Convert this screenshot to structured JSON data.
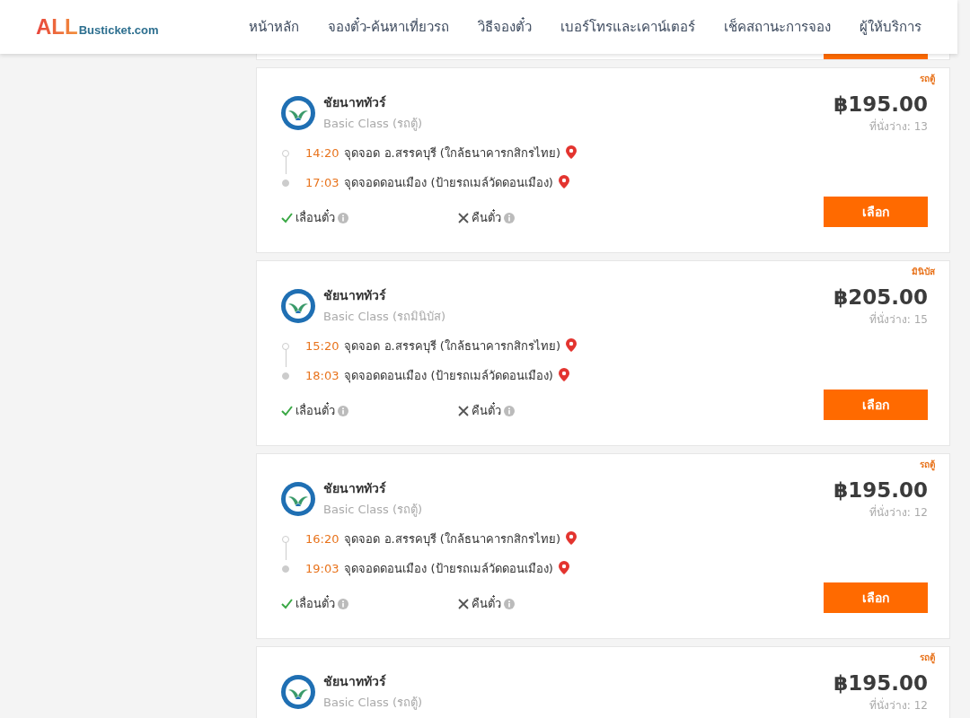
{
  "header": {
    "logo": {
      "brand": "ALL",
      "domain": "Busticket.com"
    },
    "nav": [
      "หน้าหลัก",
      "จองตั๋ว-ค้นหาเที่ยวรถ",
      "วิธีจองตั๋ว",
      "เบอร์โทรและเคาน์เตอร์",
      "เช็คสถานะการจอง",
      "ผู้ให้บริการ"
    ]
  },
  "results": [
    {
      "badge": "รถตู้",
      "operator": "ชัยนาททัวร์",
      "class": "Basic Class (รถตู้)",
      "price": "฿195.00",
      "seats": "ที่นั่งว่าง: 13",
      "stops": [
        {
          "time": "14:20",
          "place": "จุดจอด อ.สรรคบุรี (ใกล้ธนาคารกสิกรไทย)"
        },
        {
          "time": "17:03",
          "place": "จุดจอดดอนเมือง (ป้ายรถเมล์วัดดอนเมือง)"
        }
      ],
      "policies": [
        {
          "label": "เลื่อนตั๋ว",
          "allowed": true
        },
        {
          "label": "คืนตั๋ว",
          "allowed": false
        }
      ],
      "button": "เลือก"
    },
    {
      "badge": "มินิบัส",
      "operator": "ชัยนาททัวร์",
      "class": "Basic Class (รถมินิบัส)",
      "price": "฿205.00",
      "seats": "ที่นั่งว่าง: 15",
      "stops": [
        {
          "time": "15:20",
          "place": "จุดจอด อ.สรรคบุรี (ใกล้ธนาคารกสิกรไทย)"
        },
        {
          "time": "18:03",
          "place": "จุดจอดดอนเมือง (ป้ายรถเมล์วัดดอนเมือง)"
        }
      ],
      "policies": [
        {
          "label": "เลื่อนตั๋ว",
          "allowed": true
        },
        {
          "label": "คืนตั๋ว",
          "allowed": false
        }
      ],
      "button": "เลือก"
    },
    {
      "badge": "รถตู้",
      "operator": "ชัยนาททัวร์",
      "class": "Basic Class (รถตู้)",
      "price": "฿195.00",
      "seats": "ที่นั่งว่าง: 12",
      "stops": [
        {
          "time": "16:20",
          "place": "จุดจอด อ.สรรคบุรี (ใกล้ธนาคารกสิกรไทย)"
        },
        {
          "time": "19:03",
          "place": "จุดจอดดอนเมือง (ป้ายรถเมล์วัดดอนเมือง)"
        }
      ],
      "policies": [
        {
          "label": "เลื่อนตั๋ว",
          "allowed": true
        },
        {
          "label": "คืนตั๋ว",
          "allowed": false
        }
      ],
      "button": "เลือก"
    },
    {
      "badge": "รถตู้",
      "operator": "ชัยนาททัวร์",
      "class": "Basic Class (รถตู้)",
      "price": "฿195.00",
      "seats": "ที่นั่งว่าง: 12"
    }
  ]
}
